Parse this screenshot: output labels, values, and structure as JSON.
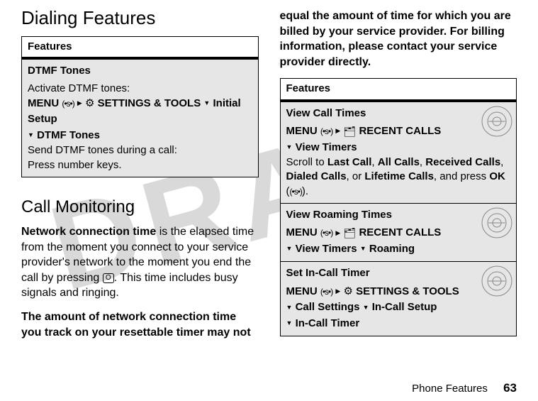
{
  "watermark": "DRAFT",
  "left": {
    "heading": "Dialing Features",
    "table_header": "Features",
    "row1": {
      "title": "DTMF Tones",
      "line1": "Activate DTMF tones:",
      "menu_prefix": "MENU",
      "menu_settings": "SETTINGS & TOOLS",
      "menu_initial": "Initial Setup",
      "menu_dtmf": "DTMF Tones",
      "line2": "Send DTMF tones during a call:",
      "line3": "Press number keys."
    },
    "call_monitoring_heading": "Call Monitoring",
    "para1_b": "Network connection time",
    "para1_rest_a": " is the elapsed time from the moment you connect to your service provider's network to the moment you end the call by pressing ",
    "para1_key": "O",
    "para1_rest_b": ". This time includes busy signals and ringing.",
    "para2": "The amount of network connection time you track on your resettable timer may not "
  },
  "right": {
    "cont": "equal the amount of time for which you are billed by your service provider. For billing information, please contact your service provider directly.",
    "table_header": "Features",
    "row1": {
      "title": "View Call Times",
      "menu_prefix": "MENU",
      "menu_recent": "RECENT CALLS",
      "menu_view_timers": "View Timers",
      "scroll_a": "Scroll to ",
      "last": "Last Call",
      "sep1": ", ",
      "all": "All Calls",
      "sep2": ", ",
      "recv": "Received Calls",
      "sep3": ", ",
      "dialed": "Dialed Calls",
      "sep4": ", or ",
      "life": "Lifetime Calls",
      "scroll_b": ", and press ",
      "ok": "OK",
      "paren_open": " (",
      "paren_close": ")."
    },
    "row2": {
      "title": "View Roaming Times",
      "menu_prefix": "MENU",
      "menu_recent": "RECENT CALLS",
      "menu_view_timers": "View Timers",
      "menu_roaming": "Roaming"
    },
    "row3": {
      "title": "Set In-Call Timer",
      "menu_prefix": "MENU",
      "menu_settings": "SETTINGS & TOOLS",
      "menu_call_settings": "Call Settings",
      "menu_incall_setup": "In-Call Setup",
      "menu_incall_timer": "In-Call Timer"
    }
  },
  "footer": {
    "section": "Phone Features",
    "page": "63"
  }
}
